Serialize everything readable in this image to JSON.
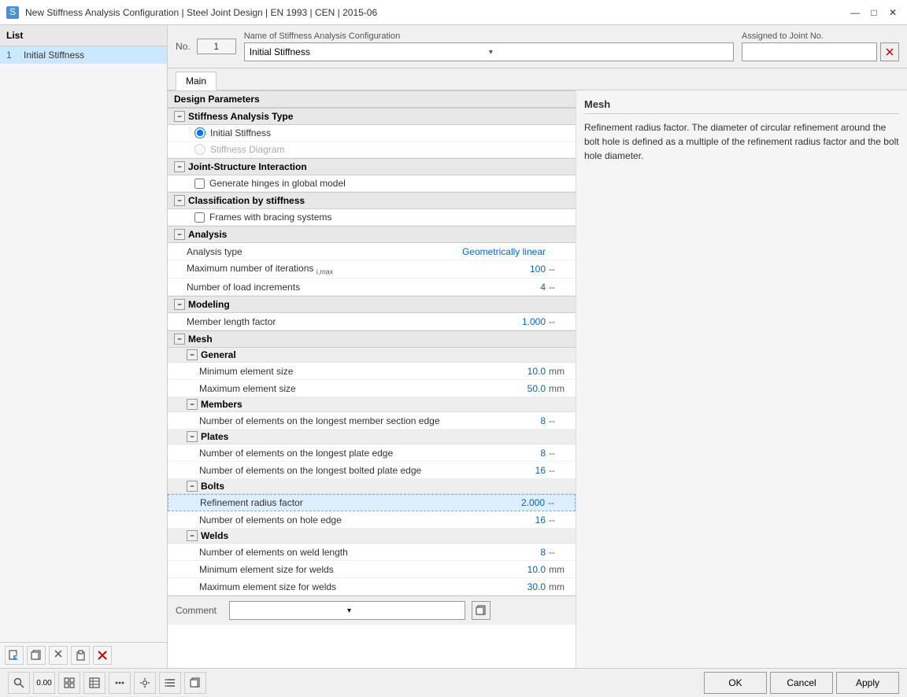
{
  "titleBar": {
    "title": "New Stiffness Analysis Configuration | Steel Joint Design | EN 1993 | CEN | 2015-06",
    "minimize": "—",
    "maximize": "□",
    "close": "✕"
  },
  "leftPanel": {
    "header": "List",
    "items": [
      {
        "number": "1",
        "name": "Initial Stiffness"
      }
    ],
    "toolbar": {
      "new": "+",
      "copy": "⧉",
      "cut": "✂",
      "paste": "📋",
      "delete": "✕"
    }
  },
  "topForm": {
    "noLabel": "No.",
    "noValue": "1",
    "nameLabel": "Name of Stiffness Analysis Configuration",
    "nameValue": "Initial Stiffness",
    "assignedLabel": "Assigned to Joint No."
  },
  "tabs": {
    "items": [
      "Main"
    ]
  },
  "designParams": {
    "sectionLabel": "Design Parameters",
    "stiffnessType": {
      "header": "Stiffness Analysis Type",
      "options": [
        {
          "label": "Initial Stiffness",
          "selected": true
        },
        {
          "label": "Stiffness Diagram",
          "selected": false,
          "disabled": true
        }
      ]
    },
    "jointStructure": {
      "header": "Joint-Structure Interaction",
      "options": [
        {
          "label": "Generate hinges in global model",
          "checked": false
        }
      ]
    },
    "classification": {
      "header": "Classification by stiffness",
      "options": [
        {
          "label": "Frames with bracing systems",
          "checked": false
        }
      ]
    },
    "analysis": {
      "header": "Analysis",
      "rows": [
        {
          "name": "Analysis type",
          "subscript": "",
          "value": "Geometrically linear",
          "unit": ""
        },
        {
          "name": "Maximum number of iterations",
          "subscript": "i,max",
          "value": "100",
          "unit": "--"
        },
        {
          "name": "Number of load increments",
          "subscript": "",
          "value": "4",
          "unit": "--"
        }
      ]
    },
    "modeling": {
      "header": "Modeling",
      "rows": [
        {
          "name": "Member length factor",
          "value": "1.000",
          "unit": "--"
        }
      ]
    },
    "mesh": {
      "header": "Mesh",
      "general": {
        "header": "General",
        "rows": [
          {
            "name": "Minimum element size",
            "value": "10.0",
            "unit": "mm"
          },
          {
            "name": "Maximum element size",
            "value": "50.0",
            "unit": "mm"
          }
        ]
      },
      "members": {
        "header": "Members",
        "rows": [
          {
            "name": "Number of elements on the longest member section edge",
            "value": "8",
            "unit": "--"
          }
        ]
      },
      "plates": {
        "header": "Plates",
        "rows": [
          {
            "name": "Number of elements on the longest plate edge",
            "value": "8",
            "unit": "--"
          },
          {
            "name": "Number of elements on the longest bolted plate edge",
            "value": "16",
            "unit": "--"
          }
        ]
      },
      "bolts": {
        "header": "Bolts",
        "rows": [
          {
            "name": "Refinement radius factor",
            "value": "2.000",
            "unit": "--",
            "selected": true
          },
          {
            "name": "Number of elements on hole edge",
            "value": "16",
            "unit": "--"
          }
        ]
      },
      "welds": {
        "header": "Welds",
        "rows": [
          {
            "name": "Number of elements on weld length",
            "value": "8",
            "unit": "--"
          },
          {
            "name": "Minimum element size for welds",
            "value": "10.0",
            "unit": "mm"
          },
          {
            "name": "Maximum element size for welds",
            "value": "30.0",
            "unit": "mm"
          }
        ]
      }
    }
  },
  "infoPanel": {
    "title": "Mesh",
    "text": "Refinement radius factor. The diameter of circular refinement around the bolt hole is defined as a multiple of the refinement radius factor and the bolt hole diameter."
  },
  "comment": {
    "label": "Comment",
    "value": "",
    "placeholder": ""
  },
  "bottomToolbar": {
    "icons": [
      "🔍",
      "0.00",
      "⊞",
      "⊡",
      "⋯",
      "⊙",
      "≡",
      "⧉"
    ]
  },
  "actionButtons": {
    "ok": "OK",
    "cancel": "Cancel",
    "apply": "Apply"
  }
}
